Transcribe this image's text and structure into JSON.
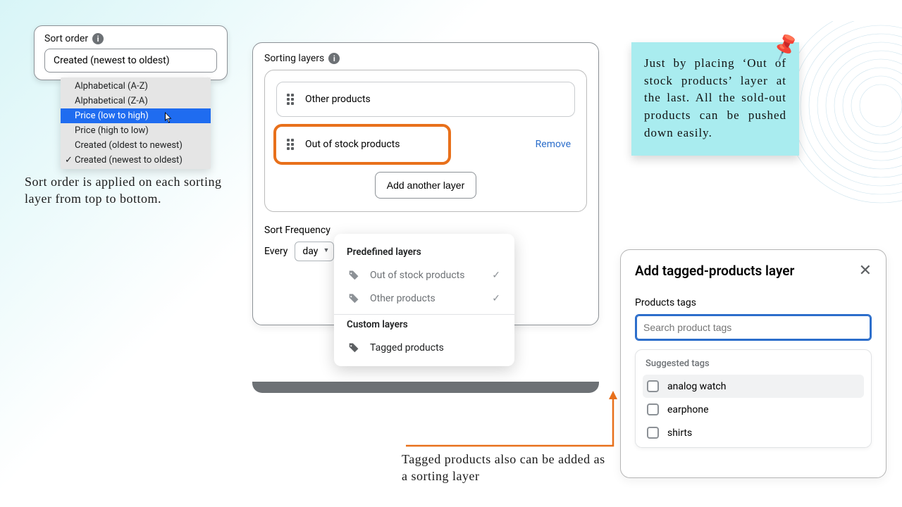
{
  "sort_order": {
    "title": "Sort order",
    "selected": "Created (newest to oldest)",
    "options": [
      {
        "label": "Alphabetical (A-Z)",
        "highlighted": false,
        "checked": false
      },
      {
        "label": "Alphabetical (Z-A)",
        "highlighted": false,
        "checked": false
      },
      {
        "label": "Price (low to high)",
        "highlighted": true,
        "checked": false
      },
      {
        "label": "Price (high to low)",
        "highlighted": false,
        "checked": false
      },
      {
        "label": "Created (oldest to newest)",
        "highlighted": false,
        "checked": false
      },
      {
        "label": "Created (newest to oldest)",
        "highlighted": false,
        "checked": true
      }
    ]
  },
  "captions": {
    "left": "Sort order is applied on each sorting layer from top to bottom.",
    "bottom": "Tagged products also can be added as a sorting layer",
    "sticky": "Just by placing ‘Out of stock products’ layer at the last. All the sold-out products can be pushed down easily."
  },
  "layers": {
    "title": "Sorting layers",
    "rows": [
      {
        "label": "Other products"
      },
      {
        "label": "Out of stock products"
      }
    ],
    "remove_label": "Remove",
    "add_label": "Add another layer"
  },
  "sort_freq": {
    "title": "Sort Frequency",
    "every_label": "Every",
    "unit": "day"
  },
  "layer_menu": {
    "predefined_title": "Predefined layers",
    "predefined": [
      {
        "label": "Out of stock products",
        "used": true
      },
      {
        "label": "Other products",
        "used": true
      }
    ],
    "custom_title": "Custom layers",
    "custom": [
      {
        "label": "Tagged products"
      }
    ]
  },
  "tag_modal": {
    "title": "Add tagged-products layer",
    "tags_label": "Products tags",
    "placeholder": "Search product tags",
    "suggested_title": "Suggested tags",
    "suggested": [
      {
        "label": "analog watch"
      },
      {
        "label": "earphone"
      },
      {
        "label": "shirts"
      }
    ]
  },
  "info_glyph": "i",
  "check_glyph": "✓"
}
